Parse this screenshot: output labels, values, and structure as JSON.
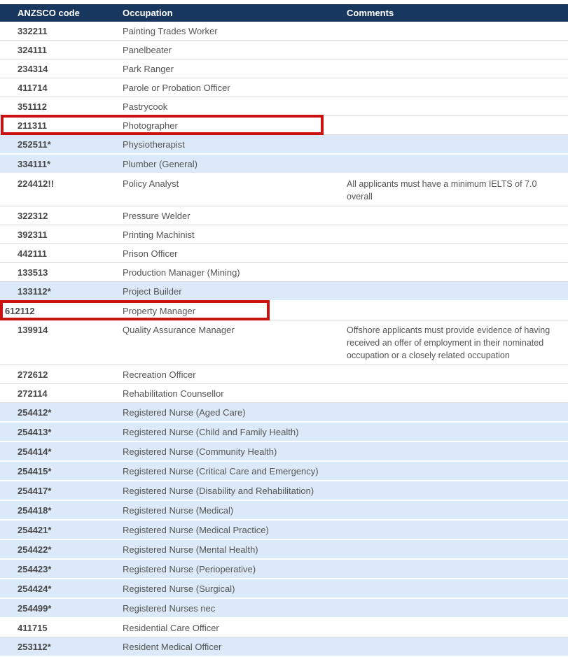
{
  "colors": {
    "header_bg": "#17375e",
    "header_text": "#ffffff",
    "shaded_row_bg": "#dbe9f9",
    "highlight_border": "#cc1111",
    "body_text": "#555555"
  },
  "table": {
    "columns": [
      "ANZSCO code",
      "Occupation",
      "Comments"
    ],
    "rows": [
      {
        "code": "332211",
        "occupation": "Painting Trades Worker",
        "comments": "",
        "shaded": false,
        "highlighted": false
      },
      {
        "code": "324111",
        "occupation": "Panelbeater",
        "comments": "",
        "shaded": false,
        "highlighted": false
      },
      {
        "code": "234314",
        "occupation": "Park Ranger",
        "comments": "",
        "shaded": false,
        "highlighted": false
      },
      {
        "code": "411714",
        "occupation": "Parole or Probation Officer",
        "comments": "",
        "shaded": false,
        "highlighted": false
      },
      {
        "code": "351112",
        "occupation": "Pastrycook",
        "comments": "",
        "shaded": false,
        "highlighted": false
      },
      {
        "code": "211311",
        "occupation": "Photographer",
        "comments": "",
        "shaded": false,
        "highlighted": true
      },
      {
        "code": "252511*",
        "occupation": "Physiotherapist",
        "comments": "",
        "shaded": true,
        "highlighted": false
      },
      {
        "code": "334111*",
        "occupation": "Plumber (General)",
        "comments": "",
        "shaded": true,
        "highlighted": false
      },
      {
        "code": "224412!!",
        "occupation": "Policy Analyst",
        "comments": "All applicants must have a minimum IELTS of 7.0 overall",
        "shaded": false,
        "highlighted": false
      },
      {
        "code": "322312",
        "occupation": "Pressure Welder",
        "comments": "",
        "shaded": false,
        "highlighted": false
      },
      {
        "code": "392311",
        "occupation": "Printing Machinist",
        "comments": "",
        "shaded": false,
        "highlighted": false
      },
      {
        "code": "442111",
        "occupation": "Prison Officer",
        "comments": "",
        "shaded": false,
        "highlighted": false
      },
      {
        "code": "133513",
        "occupation": "Production Manager (Mining)",
        "comments": "",
        "shaded": false,
        "highlighted": false
      },
      {
        "code": "133112*",
        "occupation": "Project Builder",
        "comments": "",
        "shaded": true,
        "highlighted": false
      },
      {
        "code": "612112",
        "occupation": "Property Manager",
        "comments": "",
        "shaded": false,
        "highlighted": true
      },
      {
        "code": "139914",
        "occupation": "Quality Assurance Manager",
        "comments": "Offshore applicants must provide evidence of having received an offer of employment in their nominated occupation or a closely related occupation",
        "shaded": false,
        "highlighted": false
      },
      {
        "code": "272612",
        "occupation": "Recreation Officer",
        "comments": "",
        "shaded": false,
        "highlighted": false
      },
      {
        "code": "272114",
        "occupation": "Rehabilitation Counsellor",
        "comments": "",
        "shaded": false,
        "highlighted": false
      },
      {
        "code": "254412*",
        "occupation": "Registered Nurse (Aged Care)",
        "comments": "",
        "shaded": true,
        "highlighted": false
      },
      {
        "code": "254413*",
        "occupation": "Registered Nurse (Child and Family Health)",
        "comments": "",
        "shaded": true,
        "highlighted": false
      },
      {
        "code": "254414*",
        "occupation": "Registered Nurse (Community Health)",
        "comments": "",
        "shaded": true,
        "highlighted": false
      },
      {
        "code": "254415*",
        "occupation": "Registered Nurse (Critical Care and Emergency)",
        "comments": "",
        "shaded": true,
        "highlighted": false
      },
      {
        "code": "254417*",
        "occupation": "Registered Nurse (Disability and Rehabilitation)",
        "comments": "",
        "shaded": true,
        "highlighted": false
      },
      {
        "code": "254418*",
        "occupation": "Registered Nurse (Medical)",
        "comments": "",
        "shaded": true,
        "highlighted": false
      },
      {
        "code": "254421*",
        "occupation": "Registered Nurse (Medical Practice)",
        "comments": "",
        "shaded": true,
        "highlighted": false
      },
      {
        "code": "254422*",
        "occupation": "Registered Nurse (Mental Health)",
        "comments": "",
        "shaded": true,
        "highlighted": false
      },
      {
        "code": "254423*",
        "occupation": "Registered Nurse (Perioperative)",
        "comments": "",
        "shaded": true,
        "highlighted": false
      },
      {
        "code": "254424*",
        "occupation": "Registered Nurse (Surgical)",
        "comments": "",
        "shaded": true,
        "highlighted": false
      },
      {
        "code": "254499*",
        "occupation": "Registered Nurses nec",
        "comments": "",
        "shaded": true,
        "highlighted": false
      },
      {
        "code": "411715",
        "occupation": "Residential Care Officer",
        "comments": "",
        "shaded": false,
        "highlighted": false
      },
      {
        "code": "253112*",
        "occupation": "Resident Medical Officer",
        "comments": "",
        "shaded": true,
        "highlighted": false
      }
    ]
  }
}
